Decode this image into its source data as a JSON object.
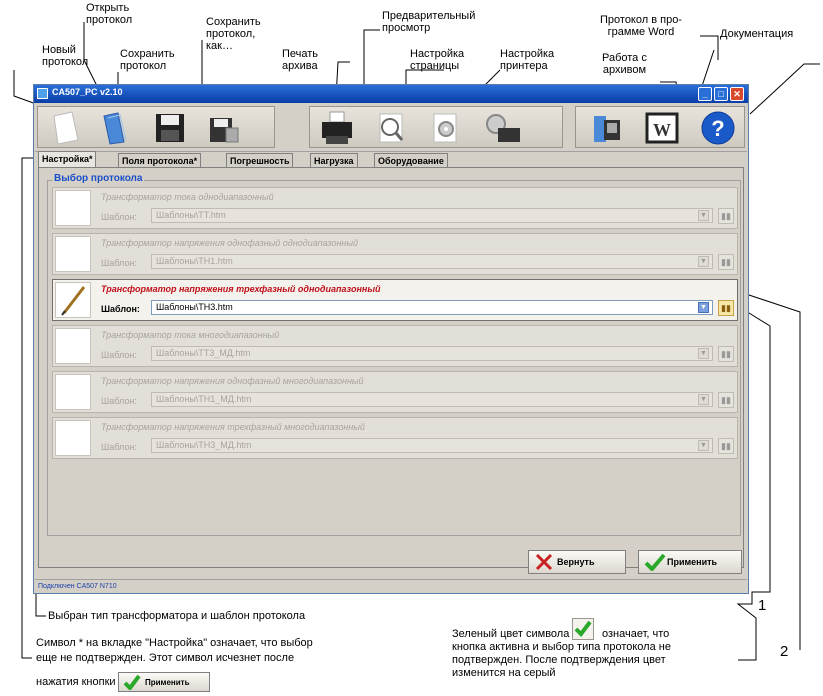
{
  "annotations": {
    "new": "Новый\nпротокол",
    "open": "Открыть\nпротокол",
    "save": "Сохранить\nпротокол",
    "save_as": "Сохранить\nпротокол,\nкак…",
    "print": "Печать\nархива",
    "preview": "Предварительный\nпросмотр",
    "page_setup": "Настройка\nстраницы",
    "printer_setup": "Настройка\nпринтера",
    "word": "Протокол в про-\nграмме Word",
    "archive": "Работа с\nархивом",
    "docs": "Документация",
    "selected_note": "Выбран тип трансформатора и шаблон протокола",
    "asterisk_note_1": "Символ * на вкладке \"Настройка\" означает, что выбор",
    "asterisk_note_2": "еще не подтвержден. Этот символ исчезнет после",
    "asterisk_note_3": "нажатия кнопки",
    "green_note_1": "Зеленый цвет символа",
    "green_note_1b": "означает, что",
    "green_note_2": "кнопка активна и выбор типа протокола не",
    "green_note_3": "подтвержден. После подтверждения цвет",
    "green_note_4": "изменится на серый",
    "marker_1": "1",
    "marker_2": "2"
  },
  "window": {
    "title": "CA507_PC v2.10",
    "status_text": "Подключен CA507 N710"
  },
  "tabs": [
    {
      "label": "Настройка*"
    },
    {
      "label": "Поля протокола*"
    },
    {
      "label": "Погрешность"
    },
    {
      "label": "Нагрузка"
    },
    {
      "label": "Оборудование"
    }
  ],
  "group_title": "Выбор протокола",
  "template_label": "Шаблон:",
  "rows": [
    {
      "title": "Трансформатор тока однодиапазонный",
      "template": "Шаблоны\\TT.htm",
      "active": false
    },
    {
      "title": "Трансформатор напряжения однофазный однодиапазонный",
      "template": "Шаблоны\\TH1.htm",
      "active": false
    },
    {
      "title": "Трансформатор напряжения трехфазный однодиапазонный",
      "template": "Шаблоны\\TH3.htm",
      "active": true
    },
    {
      "title": "Трансформатор тока многодиапазонный",
      "template": "Шаблоны\\TT3_МД.htm",
      "active": false
    },
    {
      "title": "Трансформатор напряжения однофазный многодиапазонный",
      "template": "Шаблоны\\TH1_МД.htm",
      "active": false
    },
    {
      "title": "Трансформатор напряжения трехфазный многодиапазонный",
      "template": "Шаблоны\\TH3_МД.htm",
      "active": false
    }
  ],
  "buttons": {
    "revert": "Вернуть",
    "apply": "Применить"
  },
  "colors": {
    "active_title": "#c0101a",
    "group_title": "#1a4fc8",
    "apply_check": "#2aa82a",
    "revert_cross": "#c82020"
  }
}
